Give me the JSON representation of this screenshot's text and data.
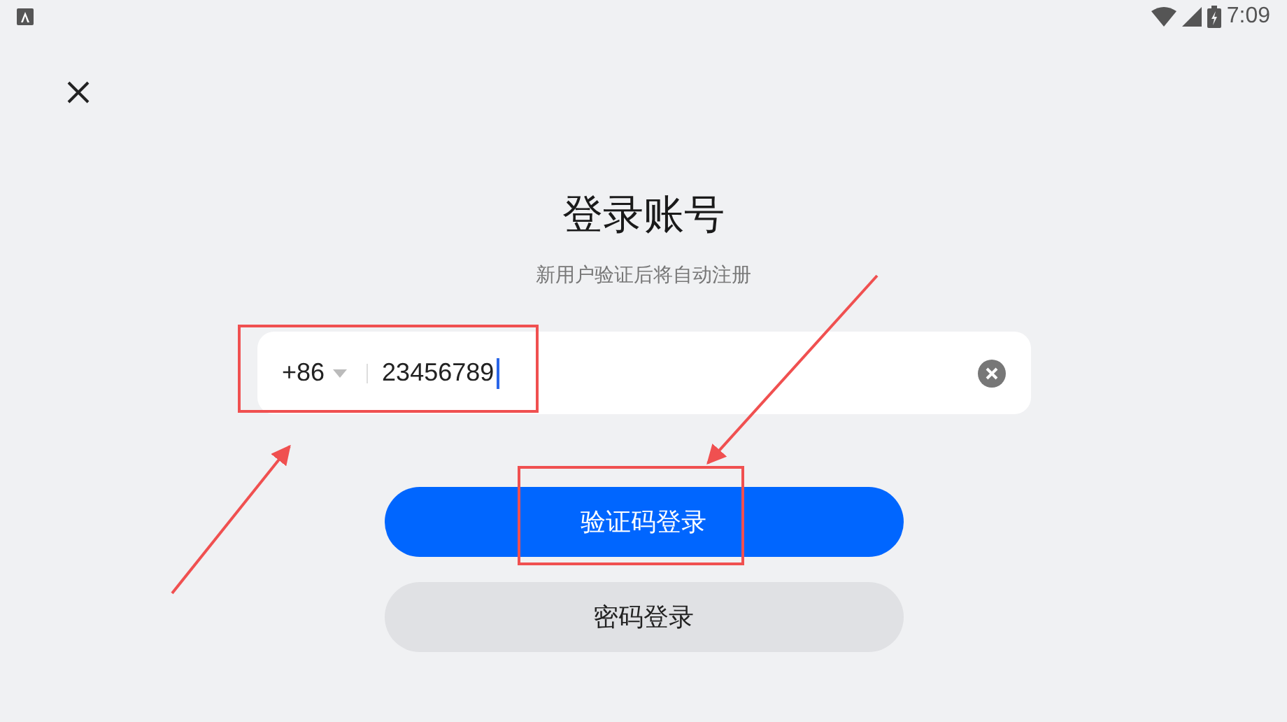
{
  "status_bar": {
    "time": "7:09"
  },
  "title": "登录账号",
  "subtitle": "新用户验证后将自动注册",
  "phone_field": {
    "country_code": "+86",
    "value": "23456789"
  },
  "buttons": [
    {
      "label": "验证码登录",
      "kind": "primary"
    },
    {
      "label": "密码登录",
      "kind": "secondary"
    }
  ]
}
